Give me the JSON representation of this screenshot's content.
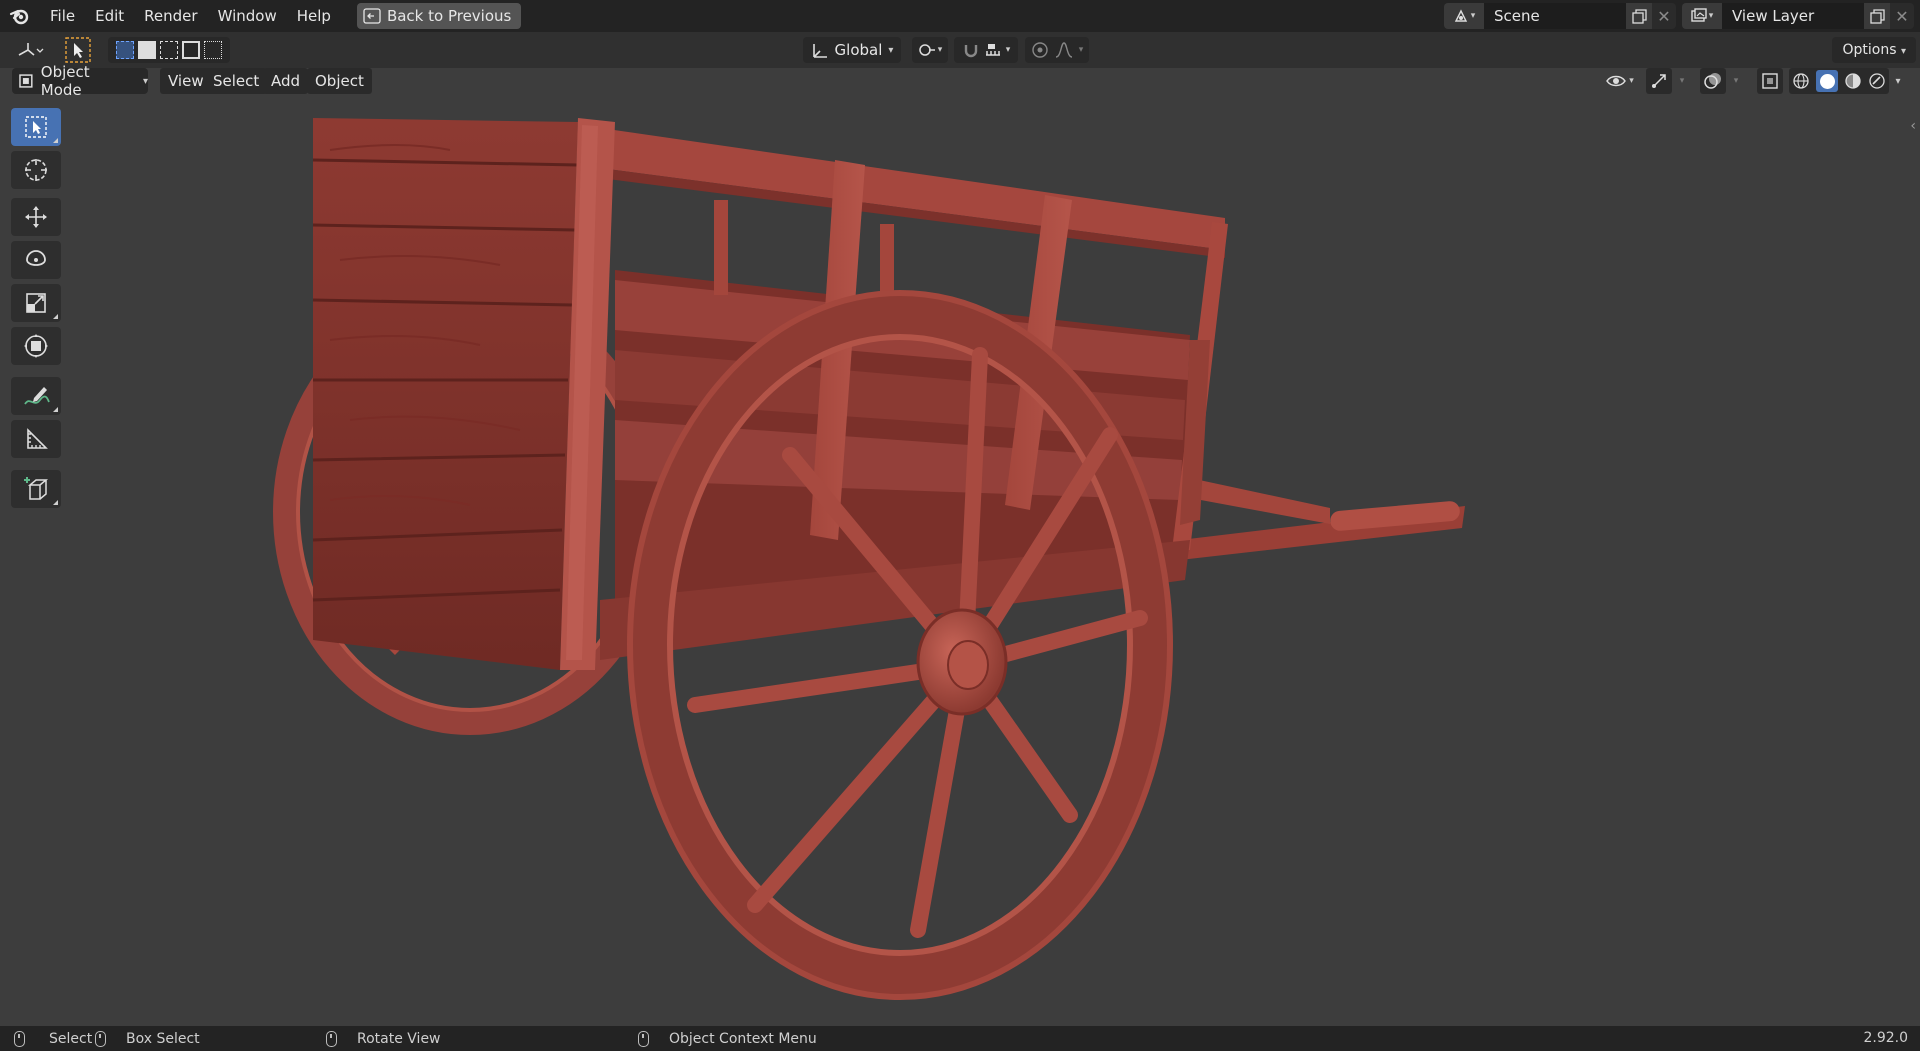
{
  "topbar": {
    "menus": [
      "File",
      "Edit",
      "Render",
      "Window",
      "Help"
    ],
    "back_button": "Back to Previous",
    "scene": {
      "value": "Scene"
    },
    "view_layer": {
      "value": "View Layer"
    }
  },
  "tool_settings": {
    "orientation": "Global",
    "options_label": "Options"
  },
  "header": {
    "mode": "Object Mode",
    "menus": [
      "View",
      "Select",
      "Add",
      "Object"
    ]
  },
  "tools": [
    {
      "name": "select-box-tool",
      "icon": "select-box-icon",
      "active": true
    },
    {
      "name": "cursor-tool",
      "icon": "cursor-icon",
      "active": false
    },
    {
      "name": "move-tool",
      "icon": "move-icon",
      "active": false
    },
    {
      "name": "rotate-tool",
      "icon": "rotate-icon",
      "active": false
    },
    {
      "name": "scale-tool",
      "icon": "scale-icon",
      "active": false
    },
    {
      "name": "transform-tool",
      "icon": "transform-icon",
      "active": false
    },
    {
      "name": "annotate-tool",
      "icon": "annotate-icon",
      "active": false
    },
    {
      "name": "measure-tool",
      "icon": "measure-icon",
      "active": false
    },
    {
      "name": "add-cube-tool",
      "icon": "add-cube-icon",
      "active": false
    }
  ],
  "status": {
    "select": "Select",
    "box_select": "Box Select",
    "rotate_view": "Rotate View",
    "context_menu": "Object Context Menu",
    "version": "2.92.0"
  },
  "colors": {
    "accent": "#4772b3",
    "viewport_bg": "#3d3d3d",
    "model": "#a8493e"
  }
}
